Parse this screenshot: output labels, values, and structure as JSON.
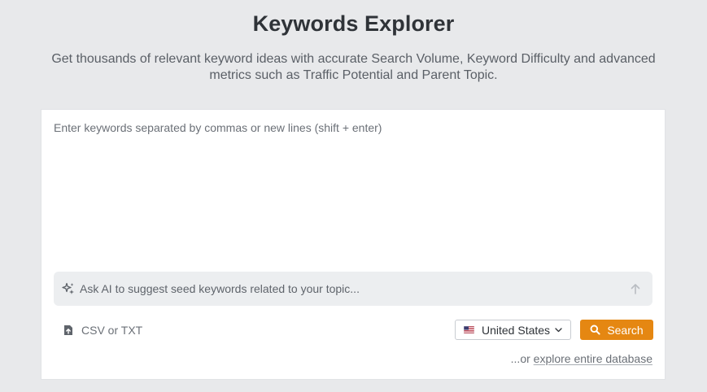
{
  "header": {
    "title": "Keywords Explorer",
    "subtitle": "Get thousands of relevant keyword ideas with accurate Search Volume, Keyword Difficulty and advanced metrics such as Traffic Potential and Parent Topic."
  },
  "keywords_input": {
    "value": "",
    "placeholder": "Enter keywords separated by commas or new lines (shift + enter)"
  },
  "ai_prompt": {
    "value": "",
    "placeholder": "Ask AI to suggest seed keywords related to your topic...",
    "icon": "sparkle-icon",
    "send_icon": "arrow-up-icon"
  },
  "upload": {
    "label": "CSV or TXT",
    "icon": "file-upload-icon"
  },
  "country": {
    "selected": "United States",
    "icon": "us-flag-icon"
  },
  "search": {
    "label": "Search",
    "icon": "search-icon",
    "color": "#e58712"
  },
  "explore": {
    "prefix": "...or ",
    "link_label": "explore entire database"
  }
}
